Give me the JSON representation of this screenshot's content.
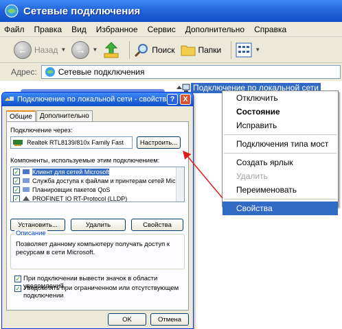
{
  "explorer": {
    "title": "Сетевые подключения",
    "menu": [
      "Файл",
      "Правка",
      "Вид",
      "Избранное",
      "Сервис",
      "Дополнительно",
      "Справка"
    ],
    "toolbar": {
      "back": "Назад",
      "search": "Поиск",
      "folders": "Папки"
    },
    "address_label": "Адрес:",
    "address_value": "Сетевые подключения",
    "connection_name": "Подключение по локальной сети"
  },
  "context_menu": {
    "items": [
      "Отключить",
      "Состояние",
      "Исправить",
      "Подключения типа мост",
      "Создать ярлык",
      "Удалить",
      "Переименовать",
      "Свойства"
    ],
    "bold_item": "Состояние",
    "disabled_item": "Удалить",
    "selected_item": "Свойства"
  },
  "dialog": {
    "title": "Подключение по локальной сети - свойства",
    "help_glyph": "?",
    "close_glyph": "X",
    "tabs": [
      "Общие",
      "Дополнительно"
    ],
    "connect_using_label": "Подключение через:",
    "adapter": "Realtek RTL8139/810x Family Fast",
    "configure_button": "Настроить...",
    "components_label": "Компоненты, используемые этим подключением:",
    "components": [
      {
        "label": "Клиент для сетей Microsoft",
        "checked": true
      },
      {
        "label": "Служба доступа к файлам и принтерам сетей Micro",
        "checked": true
      },
      {
        "label": "Планировщик пакетов QoS",
        "checked": true
      },
      {
        "label": "PROFINET IO RT-Protocol (LLDP)",
        "checked": true
      }
    ],
    "install_button": "Установить...",
    "remove_button": "Удалить",
    "properties_button": "Свойства",
    "description_title": "Описание",
    "description_text": "Позволяет данному компьютеру получать доступ к ресурсам в сети Microsoft.",
    "show_icon_checkbox": "При подключении вывести значок в области уведомлений",
    "notify_checkbox": "Уведомлять при ограниченном или отсутствующем подключении",
    "ok_button": "OK",
    "cancel_button": "Отмена",
    "check_mark": "✓"
  },
  "colors": {
    "title_blue": "#2466dc",
    "selection": "#316ac5",
    "dialog_bg": "#ece9d8",
    "arrow": "#e01c1c"
  }
}
